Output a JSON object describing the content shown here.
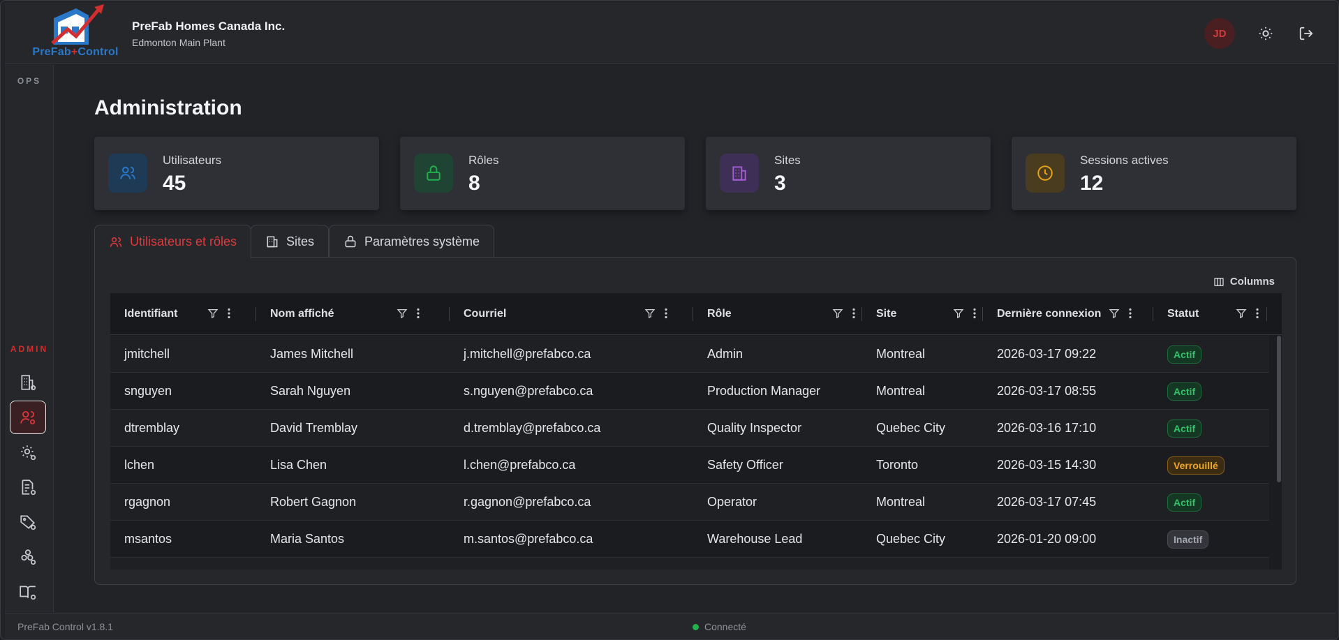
{
  "app": {
    "logo_text_a": "PreFab",
    "logo_text_plus": "+",
    "logo_text_b": "Control",
    "company_name": "PreFab Homes Canada Inc.",
    "site_name": "Edmonton Main Plant",
    "avatar_initials": "JD",
    "accent_color": "#e0393e"
  },
  "sidebar": {
    "ops_label": "OPS",
    "admin_label": "ADMIN",
    "items": [
      {
        "icon": "building-settings-icon"
      },
      {
        "icon": "users-settings-icon",
        "active": true
      },
      {
        "icon": "gear-settings-icon"
      },
      {
        "icon": "document-settings-icon"
      },
      {
        "icon": "tag-settings-icon"
      },
      {
        "icon": "boxes-settings-icon"
      },
      {
        "icon": "book-settings-icon"
      }
    ]
  },
  "page": {
    "title": "Administration"
  },
  "stats": [
    {
      "label": "Utilisateurs",
      "value": "45",
      "icon": "users-icon",
      "color": "#2a79c9"
    },
    {
      "label": "Rôles",
      "value": "8",
      "icon": "lock-icon",
      "color": "#22b14c"
    },
    {
      "label": "Sites",
      "value": "3",
      "icon": "building-icon",
      "color": "#a25cd6"
    },
    {
      "label": "Sessions actives",
      "value": "12",
      "icon": "clock-icon",
      "color": "#e8a317"
    }
  ],
  "tabs": [
    {
      "label": "Utilisateurs et rôles",
      "icon": "users-icon",
      "active": true
    },
    {
      "label": "Sites",
      "icon": "building-icon"
    },
    {
      "label": "Paramètres système",
      "icon": "lock-icon"
    }
  ],
  "table": {
    "columns_button": "Columns",
    "headers": [
      "Identifiant",
      "Nom affiché",
      "Courriel",
      "Rôle",
      "Site",
      "Dernière connexion",
      "Statut"
    ],
    "rows": [
      [
        "jmitchell",
        "James Mitchell",
        "j.mitchell@prefabco.ca",
        "Admin",
        "Montreal",
        "2026-03-17 09:22",
        "Actif"
      ],
      [
        "snguyen",
        "Sarah Nguyen",
        "s.nguyen@prefabco.ca",
        "Production Manager",
        "Montreal",
        "2026-03-17 08:55",
        "Actif"
      ],
      [
        "dtremblay",
        "David Tremblay",
        "d.tremblay@prefabco.ca",
        "Quality Inspector",
        "Quebec City",
        "2026-03-16 17:10",
        "Actif"
      ],
      [
        "lchen",
        "Lisa Chen",
        "l.chen@prefabco.ca",
        "Safety Officer",
        "Toronto",
        "2026-03-15 14:30",
        "Verrouillé"
      ],
      [
        "rgagnon",
        "Robert Gagnon",
        "r.gagnon@prefabco.ca",
        "Operator",
        "Montreal",
        "2026-03-17 07:45",
        "Actif"
      ],
      [
        "msantos",
        "Maria Santos",
        "m.santos@prefabco.ca",
        "Warehouse Lead",
        "Quebec City",
        "2026-01-20 09:00",
        "Inactif"
      ]
    ]
  },
  "footer": {
    "version": "PreFab Control v1.8.1",
    "connection": "Connecté"
  }
}
